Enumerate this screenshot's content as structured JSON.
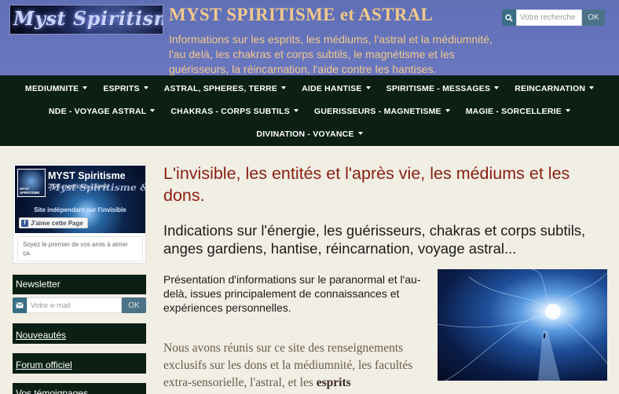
{
  "header": {
    "logo_text": "Myst Spiritisme",
    "title": "MYST SPIRITISME et ASTRAL",
    "description": "Informations sur les esprits, les médiums, l'astral et la médiumnité, l'au delà, les chakras et corps subtils, le magnétisme et les guérisseurs, la réincarnation, l'aide contre les hantises."
  },
  "search": {
    "icon": "search-icon",
    "placeholder": "Votre recherche",
    "button_label": "OK"
  },
  "nav": {
    "rows": [
      [
        "MEDIUMNITE",
        "ESPRITS",
        "ASTRAL, SPHERES, TERRE",
        "AIDE HANTISE",
        "SPIRITISME - MESSAGES",
        "REINCARNATION"
      ],
      [
        "NDE - VOYAGE ASTRAL",
        "CHAKRAS - CORPS SUBTILS",
        "GUERISSEURS - MAGNETISME",
        "MAGIE - SORCELLERIE"
      ],
      [
        "DIVINATION - VOYANCE"
      ]
    ]
  },
  "facebook": {
    "page_name": "MYST Spiritisme",
    "likes": "2,9K mentions J'aime",
    "overlay_title": "Myst Spiritisme & Astral",
    "tagline": "Site indépendant sur l'invisible",
    "avatar_text": "MYST SPIRITISME",
    "like_button": "J'aime cette Page",
    "friends_text": "Soyez le premier de vos amis à aimer ça."
  },
  "sidebar": {
    "newsletter_title": "Newsletter",
    "email_placeholder": "Votre e-mail",
    "newsletter_ok": "OK",
    "links": [
      "Nouveautés",
      "Forum officiel",
      "Vos témoignages"
    ]
  },
  "main": {
    "title": "L'invisible, les entités et l'après vie, les médiums et les dons.",
    "subtitle": "Indications sur l'énergie, les guérisseurs, chakras et corps subtils, anges gardiens, hantise, réincarnation, voyage astral...",
    "intro": "Présentation d'informations sur le paranormal et l'au-delà, issues principalement de connaissances et expériences personnelles.",
    "paragraph_start": "Nous avons réunis sur ce site des renseignements exclusifs sur les dons et la médiumnité, les facultés extra-sensorielle, l'astral, et les ",
    "paragraph_bold": "esprits"
  },
  "colors": {
    "header_bg": "#6572bb",
    "title": "#f3c98a",
    "nav_bg": "#0b1f14",
    "heading_red": "#8a1e10",
    "button_blue": "#4b7388"
  }
}
